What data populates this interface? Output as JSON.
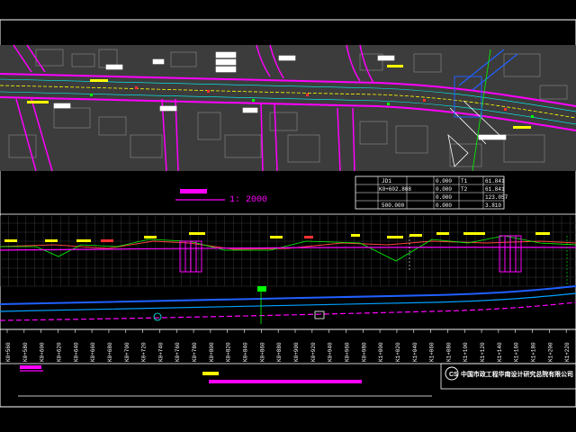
{
  "plan": {
    "scale_title": "1: 2000",
    "table": [
      [
        "JD1",
        "",
        "0.000",
        "T1",
        "61.841"
      ],
      [
        "",
        "K0+602.808",
        "0.000",
        "T2",
        "61.841"
      ],
      [
        "",
        "",
        "0.000",
        "",
        "123.057"
      ],
      [
        "",
        "500.000",
        "0.000",
        "",
        "3.810"
      ]
    ]
  },
  "profile": {
    "stations": [
      "K0+560",
      "K0+580",
      "K0+600",
      "K0+620",
      "K0+640",
      "K0+660",
      "K0+680",
      "K0+700",
      "K0+720",
      "K0+740",
      "K0+760",
      "K0+780",
      "K0+800",
      "K0+820",
      "K0+840",
      "K0+860",
      "K0+880",
      "K0+900",
      "K0+920",
      "K0+940",
      "K0+960",
      "K0+980",
      "K1+000",
      "K1+020",
      "K1+040",
      "K1+060",
      "K1+080",
      "K1+100",
      "K1+120",
      "K1+140",
      "K1+160",
      "K1+180",
      "K1+200",
      "K1+220"
    ]
  },
  "footer": {
    "company_name": "中国市政工程华南设计研究总院有限公司"
  },
  "colors": {
    "road_magenta": "#ff00ff",
    "pipe_blue": "#2060ff",
    "grade_green": "#00ff00",
    "plan_bg": "#3c3c3c",
    "frame": "#ffffff"
  }
}
